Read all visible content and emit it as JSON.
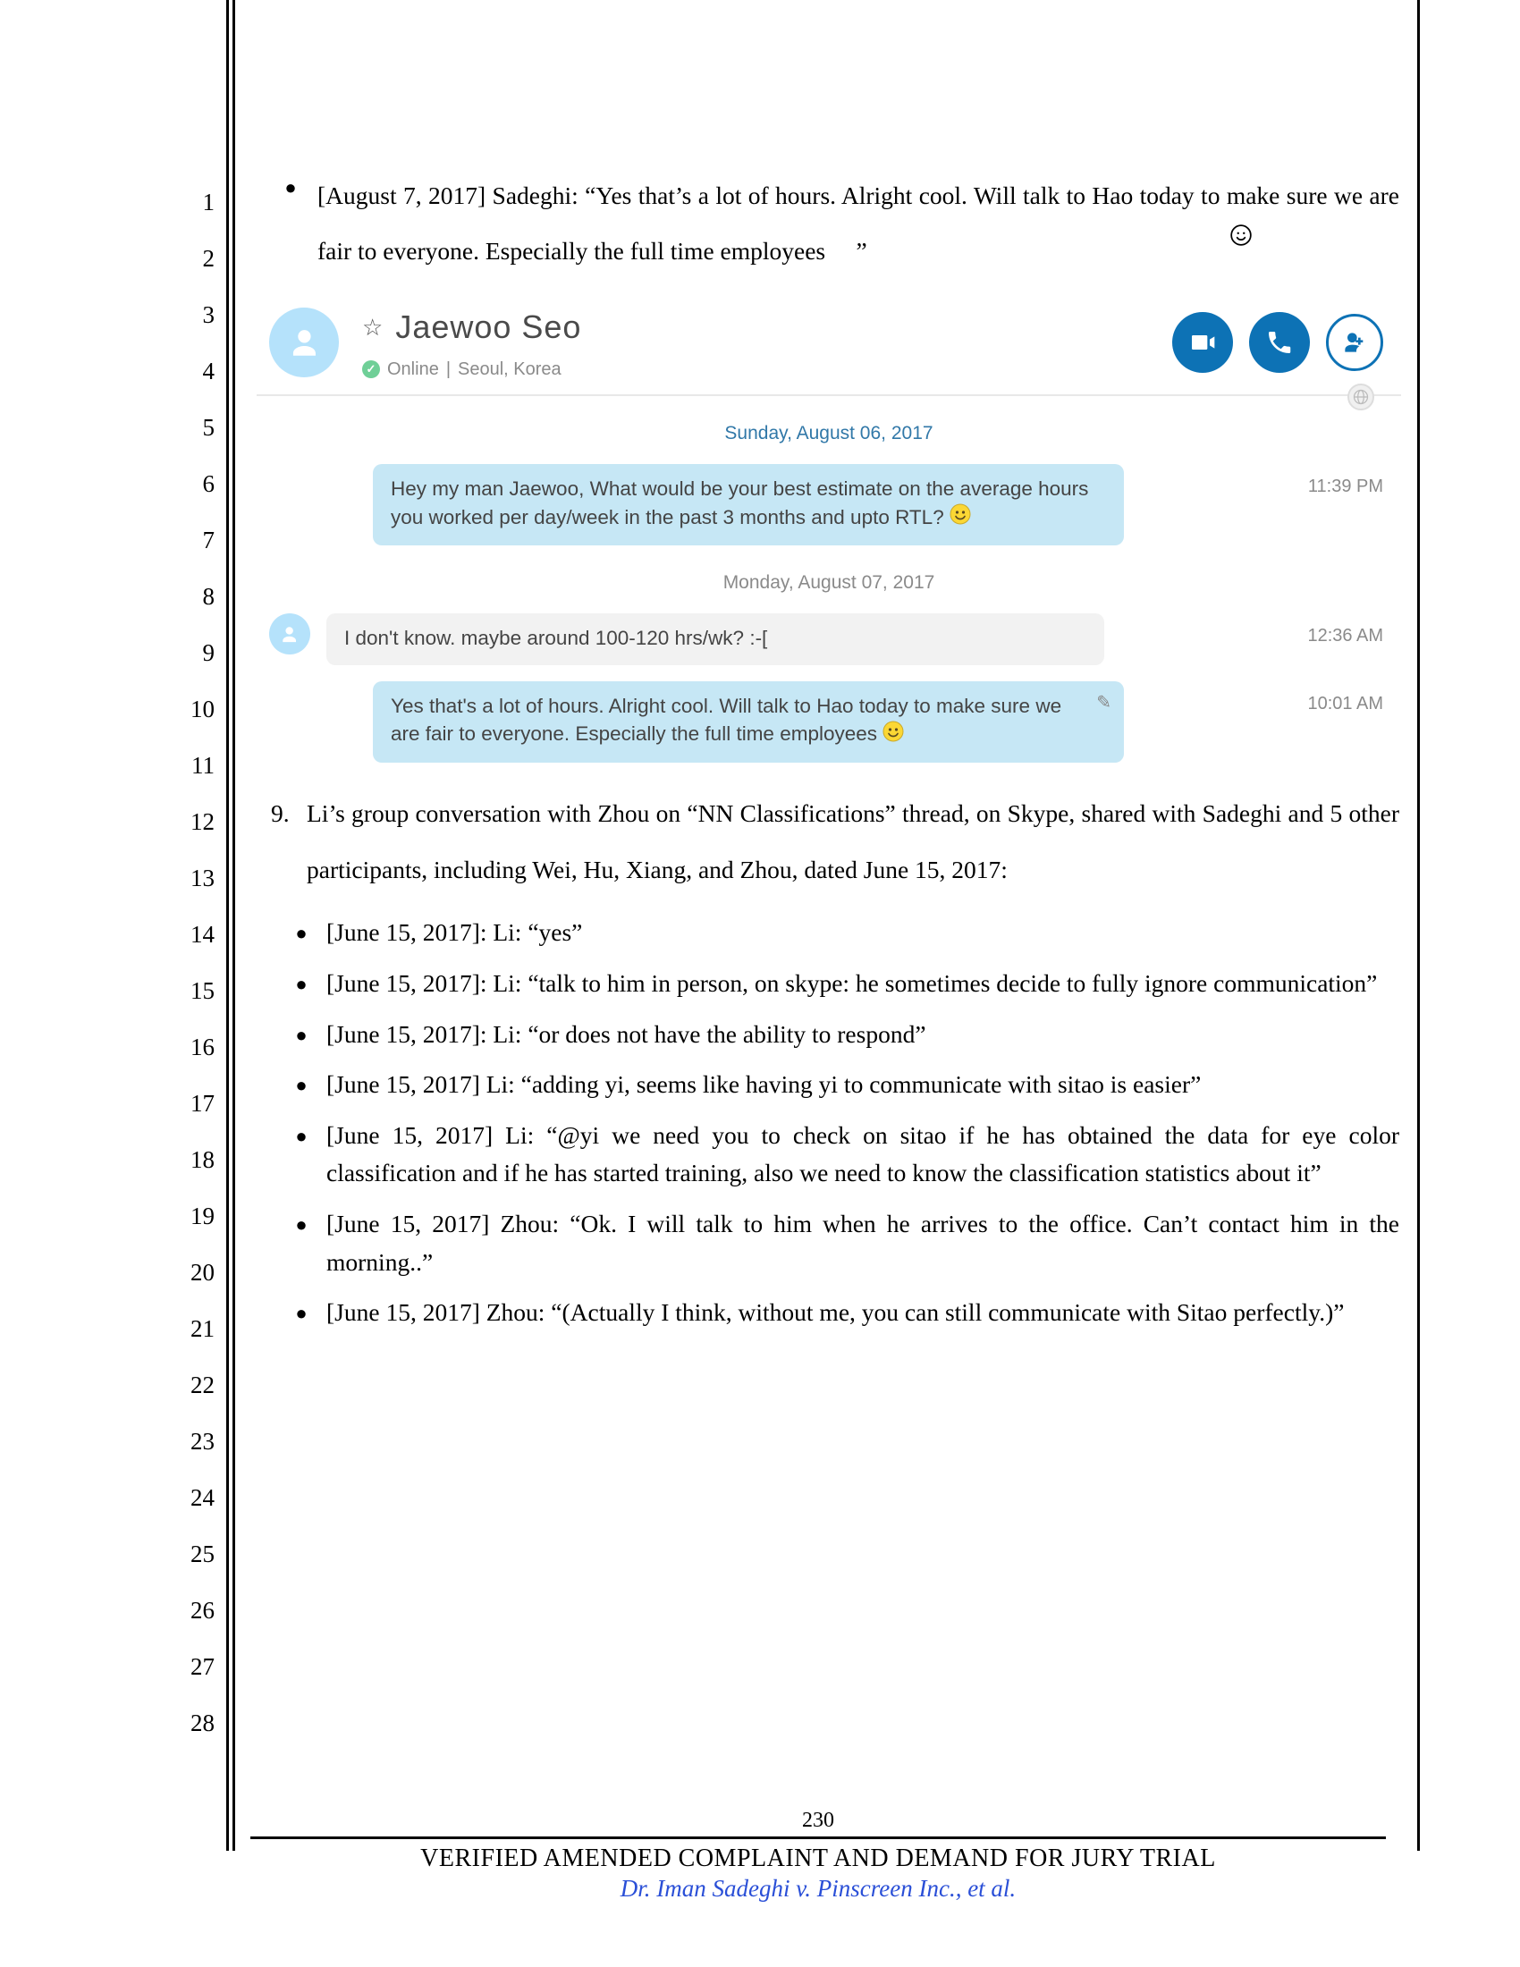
{
  "lineNumbers": [
    "1",
    "2",
    "3",
    "4",
    "5",
    "6",
    "7",
    "8",
    "9",
    "10",
    "11",
    "12",
    "13",
    "14",
    "15",
    "16",
    "17",
    "18",
    "19",
    "20",
    "21",
    "22",
    "23",
    "24",
    "25",
    "26",
    "27",
    "28"
  ],
  "topBullet": "[August 7, 2017] Sadeghi: “Yes that’s a lot of hours. Alright cool. Will talk to Hao today to make sure we are fair to everyone. Especially the full time employees     ”",
  "skype": {
    "contactName": "Jaewoo Seo",
    "status": "Online",
    "location": "Seoul, Korea",
    "date1": "Sunday, August 06, 2017",
    "date2": "Monday, August 07, 2017",
    "messages": [
      {
        "side": "out",
        "text": "Hey my man Jaewoo, What would be your best estimate on the average hours you worked per day/week in the past 3 months and upto RTL? ",
        "emoji": true,
        "time": "11:39 PM"
      },
      {
        "side": "in",
        "text": "I don't know. maybe around 100-120 hrs/wk? :-[",
        "emoji": false,
        "time": "12:36 AM"
      },
      {
        "side": "out",
        "text": "Yes that's a lot of hours. Alright cool. Will talk to Hao today to make sure we are fair to everyone. Especially the full time employees ",
        "emoji": true,
        "time": "10:01 AM",
        "edited": true
      }
    ]
  },
  "para9_num": "9.",
  "para9": "Li’s group conversation with Zhou on “NN Classifications” thread, on Skype, shared with Sadeghi and 5 other participants, including Wei, Hu, Xiang, and Zhou, dated June 15, 2017:",
  "subBullets": [
    "[June 15, 2017]: Li: “yes”",
    "[June 15, 2017]: Li: “talk to him in person, on skype: he sometimes decide to fully ignore communication”",
    "[June 15, 2017]: Li: “or does not have the ability to respond”",
    "[June 15, 2017] Li: “adding yi, seems like having yi to communicate with sitao is easier”",
    "[June 15, 2017] Li: “@yi we need you to check on sitao if he has obtained the data for eye color classification and if he has started training, also we need to know the classification statistics about it”",
    "[June 15, 2017] Zhou: “Ok. I will talk to him when he arrives to the office. Can’t contact him in the morning..”",
    "[June 15, 2017] Zhou: “(Actually I think, without me, you can still communicate with Sitao perfectly.)”"
  ],
  "footer": {
    "pageNum": "230",
    "title": "VERIFIED AMENDED COMPLAINT AND DEMAND FOR JURY TRIAL",
    "case": "Dr. Iman Sadeghi v. Pinscreen Inc., et al."
  }
}
